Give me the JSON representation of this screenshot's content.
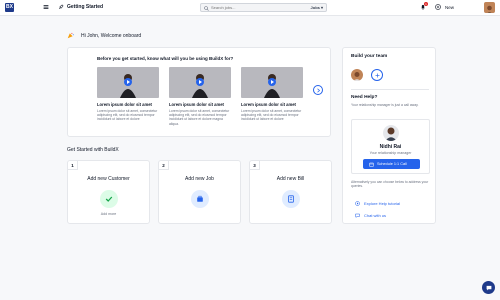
{
  "topbar": {
    "logo_text": "BX",
    "page_title": "Getting Started",
    "search_placeholder": "Search jobs...",
    "search_scope": "Jobs",
    "notification_count": "1",
    "new_label": "New"
  },
  "welcome": "Hi John, Welcome onboard",
  "videos": {
    "title": "Before you get started, know what will you be using BuildX for?",
    "items": [
      {
        "title": "Lorem ipsum dolor sit amet",
        "desc": "Lorem ipsum dolor sit amet, consectetur adipiscing elit, sed do eiusmod tempor incididunt ut labore et dolore"
      },
      {
        "title": "Lorem ipsum dolor sit amet",
        "desc": "Lorem ipsum dolor sit amet, consectetur adipiscing elit, sed do eiusmod tempor incididunt ut labore et dolore magna aliqua."
      },
      {
        "title": "Lorem ipsum dolor sit amet",
        "desc": "Lorem ipsum dolor sit amet, consectetur adipiscing elit, sed do eiusmod tempor incididunt ut labore et dolore"
      }
    ]
  },
  "get_started": {
    "title": "Get Started with BuildX",
    "steps": [
      {
        "num": "1",
        "title": "Add new Customer",
        "sub": "Add more",
        "done": true
      },
      {
        "num": "2",
        "title": "Add new Job",
        "sub": "",
        "done": false
      },
      {
        "num": "3",
        "title": "Add new Bill",
        "sub": "",
        "done": false
      }
    ]
  },
  "side": {
    "team_title": "Build your team",
    "help_title": "Need Help?",
    "help_desc": "Your relationship manager is just a call away.",
    "manager_name": "Nidhi Rai",
    "manager_role": "Your relationship manager",
    "schedule_label": "Schedule 1:1 Call",
    "alt_text": "Alternatively you can choose below to address your queries.",
    "link_tutorial": "Explore Help tutorial",
    "link_chat": "Chat with us"
  },
  "colors": {
    "accent": "#2563eb",
    "brand": "#1e3a8a",
    "success_bg": "#dcfce7",
    "success": "#16a34a",
    "icon_bg": "#e0ecff"
  },
  "icons": [
    "menu-icon",
    "rocket-icon",
    "search-icon",
    "bell-icon",
    "plus-icon",
    "party-icon",
    "play-icon",
    "chevron-right-icon",
    "check-icon",
    "job-icon",
    "bill-icon",
    "calendar-icon",
    "tutorial-icon",
    "chat-icon"
  ]
}
